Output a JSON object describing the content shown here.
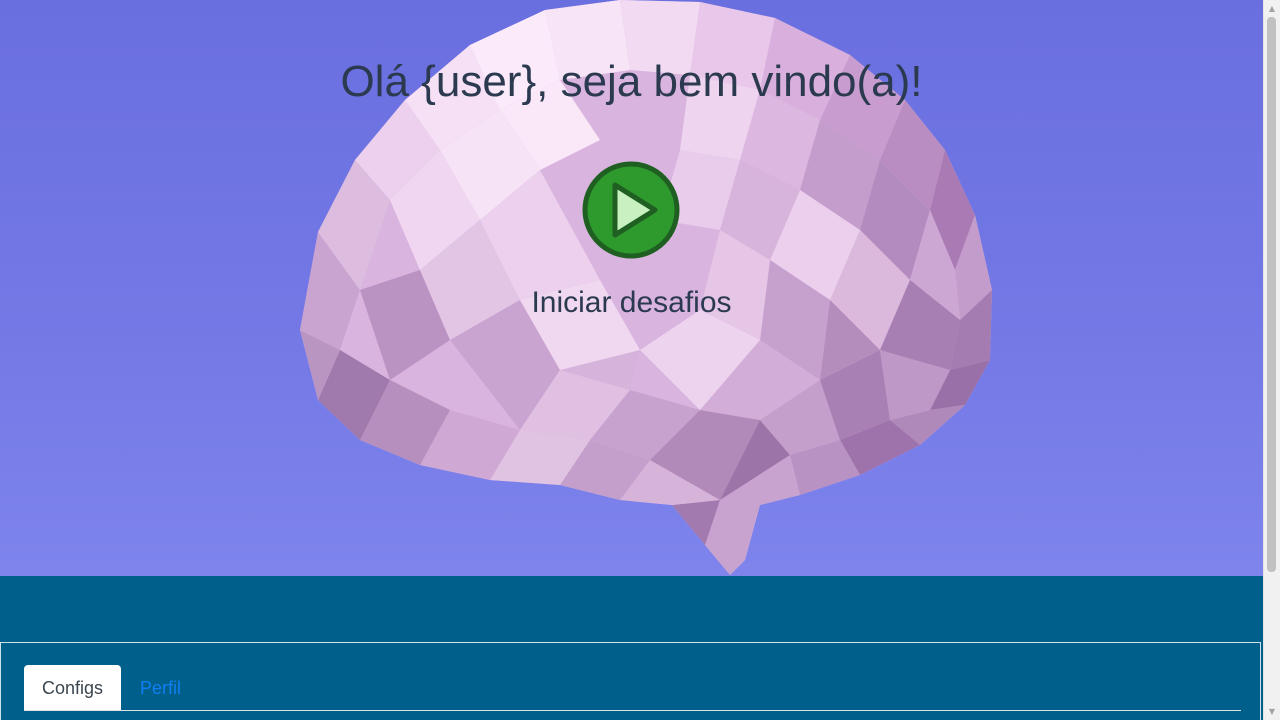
{
  "hero": {
    "title": "Olá {user}, seja bem vindo(a)!",
    "play_label": "Iniciar desafios",
    "play_icon": "play-icon",
    "background_color": "#6a6fe0",
    "image_subject": "low-poly-brain"
  },
  "tabs": [
    {
      "label": "Configs",
      "active": true
    },
    {
      "label": "Perfil",
      "active": false
    }
  ],
  "colors": {
    "band": "#00608b",
    "play_green": "#2e9a2e",
    "tab_link": "#0d7ff2",
    "title_text": "#2b3a4f"
  }
}
